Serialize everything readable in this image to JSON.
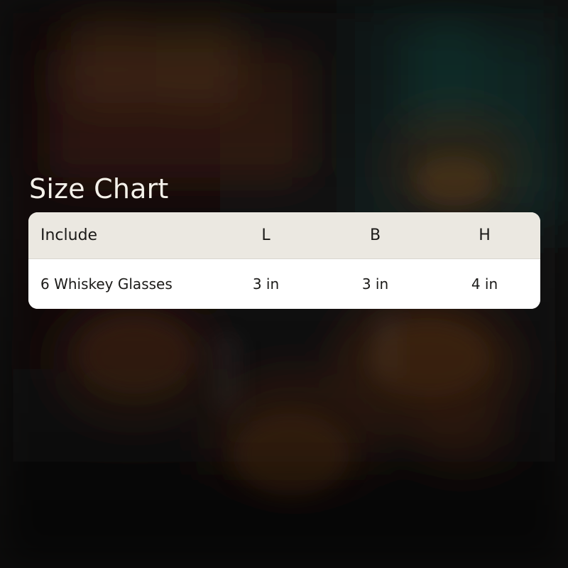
{
  "title": "Size Chart",
  "table": {
    "headers": [
      "Include",
      "L",
      "B",
      "H"
    ],
    "rows": [
      [
        "6 Whiskey Glasses",
        "3 in",
        "3 in",
        "4 in"
      ]
    ]
  },
  "colors": {
    "background": "#141211",
    "header_fill": "#ebe8e1",
    "row_fill": "#ffffff",
    "title_text": "#f4f1ea",
    "table_text": "#1b1a18"
  }
}
